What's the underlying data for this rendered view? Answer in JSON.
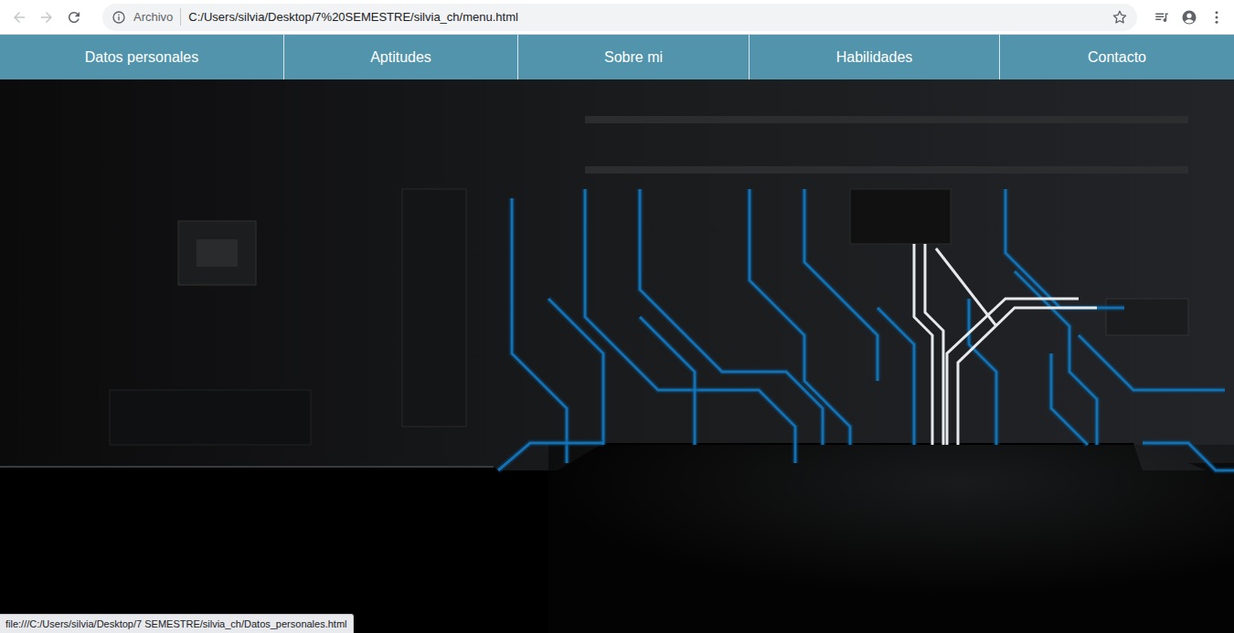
{
  "browser": {
    "back_enabled": false,
    "forward_enabled": false,
    "security_label": "Archivo",
    "address": "C:/Users/silvia/Desktop/7%20SEMESTRE/silvia_ch/menu.html"
  },
  "menu": {
    "items": [
      {
        "label": "Datos personales"
      },
      {
        "label": "Aptitudes"
      },
      {
        "label": "Sobre mi"
      },
      {
        "label": "Habilidades"
      },
      {
        "label": "Contacto"
      }
    ]
  },
  "status_bar": "file:///C:/Users/silvia/Desktop/7 SEMESTRE/silvia_ch/Datos_personales.html"
}
